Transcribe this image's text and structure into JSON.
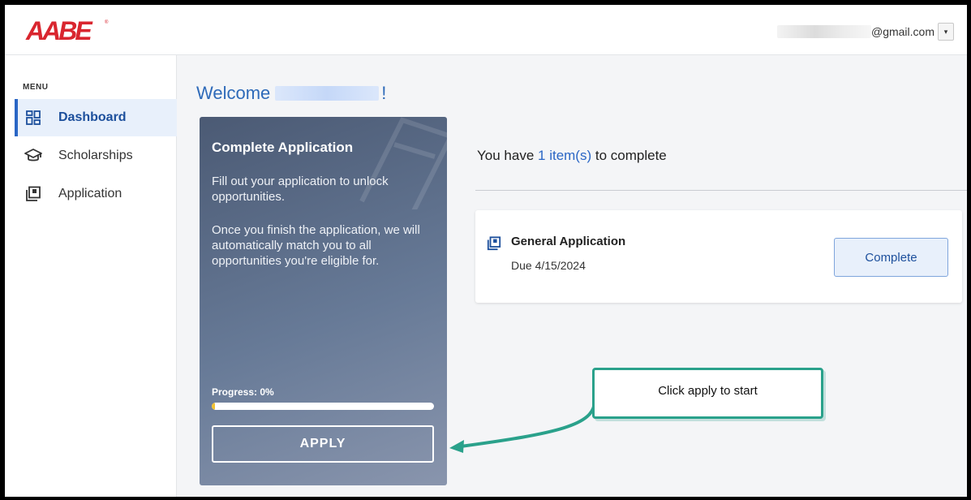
{
  "header": {
    "logo_text": "AABE",
    "account_email": "@gmail.com",
    "account_dropdown_glyph": "▾"
  },
  "sidebar": {
    "menu_label": "MENU",
    "items": [
      {
        "label": "Dashboard",
        "icon": "dashboard-icon",
        "active": true
      },
      {
        "label": "Scholarships",
        "icon": "graduation-cap-icon",
        "active": false
      },
      {
        "label": "Application",
        "icon": "application-icon",
        "active": false
      }
    ]
  },
  "main": {
    "welcome_prefix": "Welcome",
    "welcome_suffix": "!",
    "application_card": {
      "title": "Complete Application",
      "description_1": "Fill out your application to unlock opportunities.",
      "description_2": "Once you finish the application, we will automatically match you to all opportunities you're eligible for.",
      "progress_label": "Progress: 0%",
      "progress_value": 0,
      "apply_label": "APPLY"
    },
    "items": {
      "heading_prefix": "You have",
      "heading_count": "1 item(s)",
      "heading_suffix": "to complete",
      "tasks": [
        {
          "title": "General Application",
          "due": "Due 4/15/2024",
          "action_label": "Complete"
        }
      ]
    }
  },
  "annotation": {
    "callout_text": "Click apply to start"
  },
  "colors": {
    "brand_red": "#d9262f",
    "primary_blue": "#2a66c5",
    "annotation_green": "#2aa18b",
    "progress_yellow": "#f1c232"
  }
}
